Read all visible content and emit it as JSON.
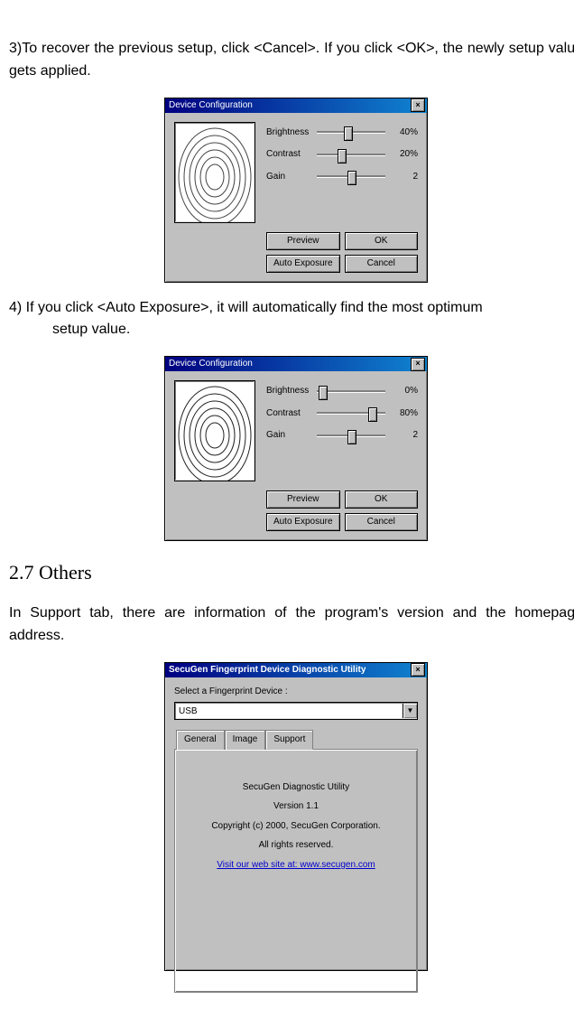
{
  "paragraphs": {
    "p1": "3)To recover the previous setup, click <Cancel>.  If you click  <OK>, the newly setup value gets applied.",
    "p2a": "4) If you click <Auto Exposure>, it will automatically find the most optimum",
    "p2b": "setup value.",
    "sec": "2.7 Others",
    "p3": "In Support tab, there are information of the program's version and the homepage address."
  },
  "dlg1": {
    "title": "Device Configuration",
    "close": "×",
    "sliders": {
      "brightness": {
        "label": "Brightness",
        "value": "40%",
        "pos": 40
      },
      "contrast": {
        "label": "Contrast",
        "value": "20%",
        "pos": 30
      },
      "gain": {
        "label": "Gain",
        "value": "2",
        "pos": 45
      }
    },
    "buttons": {
      "preview": "Preview",
      "ok": "OK",
      "auto": "Auto Exposure",
      "cancel": "Cancel"
    }
  },
  "dlg2": {
    "title": "Device Configuration",
    "close": "×",
    "sliders": {
      "brightness": {
        "label": "Brightness",
        "value": "0%",
        "pos": 2
      },
      "contrast": {
        "label": "Contrast",
        "value": "80%",
        "pos": 75
      },
      "gain": {
        "label": "Gain",
        "value": "2",
        "pos": 45
      }
    },
    "buttons": {
      "preview": "Preview",
      "ok": "OK",
      "auto": "Auto Exposure",
      "cancel": "Cancel"
    }
  },
  "diag": {
    "title": "SecuGen Fingerprint Device Diagnostic Utility",
    "close": "×",
    "select_label": "Select a Fingerprint Device :",
    "select_value": "USB",
    "combo_arrow": "▼",
    "tabs": {
      "general": "General",
      "image": "Image",
      "support": "Support"
    },
    "support": {
      "line1": "SecuGen Diagnostic Utility",
      "line2": "Version 1.1",
      "line3": "Copyright (c) 2000, SecuGen Corporation.",
      "line4": "All rights reserved.",
      "link": "Visit our web site at: www.secugen.com"
    }
  }
}
